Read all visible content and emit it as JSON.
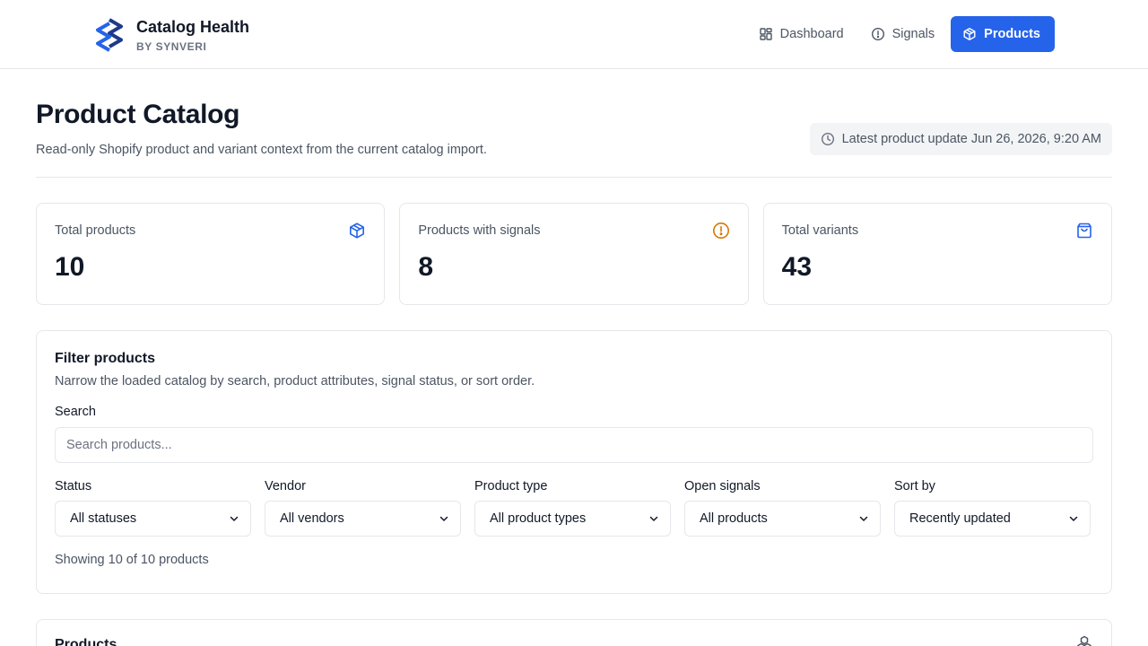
{
  "brand": {
    "title": "Catalog Health",
    "subtitle": "BY SYNVERI"
  },
  "nav": {
    "items": [
      {
        "label": "Dashboard",
        "icon": "dashboard-icon",
        "active": false
      },
      {
        "label": "Signals",
        "icon": "alert-circle-icon",
        "active": false
      },
      {
        "label": "Products",
        "icon": "box-icon",
        "active": true
      }
    ]
  },
  "page": {
    "title": "Product Catalog",
    "description": "Read-only Shopify product and variant context from the current catalog import.",
    "latest_update": "Latest product update Jun 26, 2026, 9:20 AM"
  },
  "stats": [
    {
      "label": "Total products",
      "value": "10",
      "icon": "box-icon",
      "color": "#2563eb"
    },
    {
      "label": "Products with signals",
      "value": "8",
      "icon": "alert-circle-icon",
      "color": "#d97706"
    },
    {
      "label": "Total variants",
      "value": "43",
      "icon": "shopping-bag-icon",
      "color": "#2563eb"
    }
  ],
  "filters": {
    "title": "Filter products",
    "description": "Narrow the loaded catalog by search, product attributes, signal status, or sort order.",
    "search_label": "Search",
    "search_placeholder": "Search products...",
    "search_value": "",
    "selects": [
      {
        "label": "Status",
        "value": "All statuses"
      },
      {
        "label": "Vendor",
        "value": "All vendors"
      },
      {
        "label": "Product type",
        "value": "All product types"
      },
      {
        "label": "Open signals",
        "value": "All products"
      },
      {
        "label": "Sort by",
        "value": "Recently updated"
      }
    ],
    "showing": "Showing 10 of 10 products"
  },
  "products": {
    "title": "Products",
    "icon": "boxes-icon"
  },
  "colors": {
    "accent": "#2563eb",
    "warning": "#d97706",
    "border": "#e5e7eb",
    "muted": "#4b5563"
  }
}
